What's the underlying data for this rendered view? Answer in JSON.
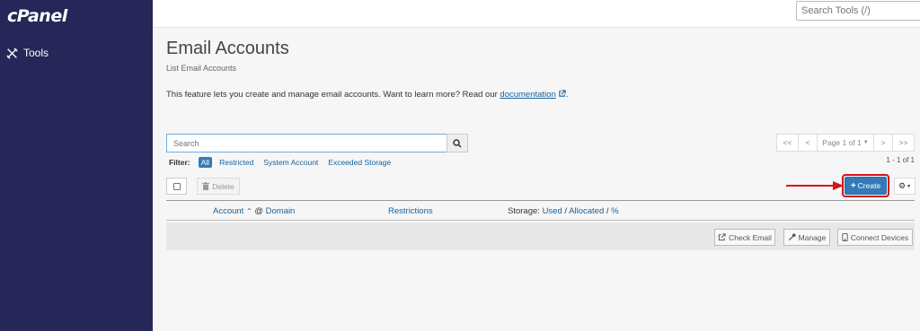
{
  "sidebar": {
    "logo": "cPanel",
    "items": [
      {
        "label": "Tools",
        "icon": "tools-icon"
      }
    ]
  },
  "topbar": {
    "search_placeholder": "Search Tools (/)"
  },
  "page": {
    "title": "Email Accounts",
    "subtitle": "List Email Accounts",
    "description_prefix": "This feature lets you create and manage email accounts. Want to learn more? Read our ",
    "description_link": "documentation",
    "description_suffix": "."
  },
  "search": {
    "placeholder": "Search"
  },
  "pagination": {
    "first": "<<",
    "prev": "<",
    "page_label": "Page 1 of 1",
    "next": ">",
    "last": ">>",
    "range": "1 - 1 of 1"
  },
  "filter": {
    "label": "Filter:",
    "options": [
      "All",
      "Restricted",
      "System Account",
      "Exceeded Storage"
    ],
    "active": "All"
  },
  "toolbar": {
    "delete_label": "Delete",
    "create_label": "Create"
  },
  "table": {
    "columns": {
      "account": "Account",
      "at": "@",
      "domain": "Domain",
      "restrictions": "Restrictions",
      "storage_prefix": "Storage:",
      "used": "Used",
      "sep1": "/",
      "allocated": "Allocated",
      "sep2": "/",
      "percent": "%"
    },
    "row_actions": [
      "Check Email",
      "Manage",
      "Connect Devices"
    ]
  },
  "colors": {
    "sidebar_bg": "#262658",
    "primary": "#337ab7",
    "link": "#17639e",
    "highlight": "#d3131a"
  }
}
